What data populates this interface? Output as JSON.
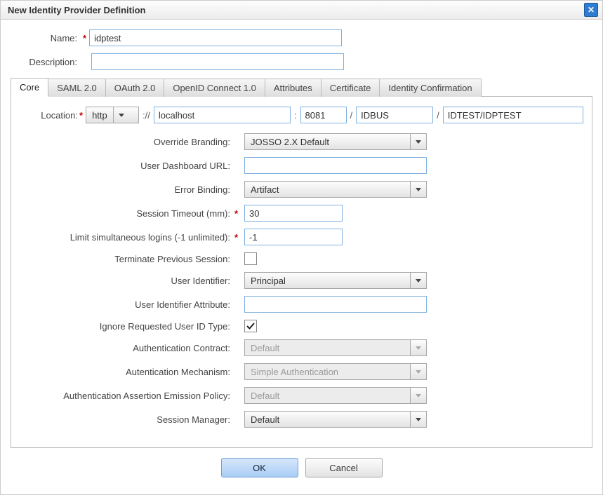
{
  "dialog": {
    "title": "New Identity Provider Definition"
  },
  "header": {
    "name_label": "Name:",
    "name_value": "idptest",
    "description_label": "Description:",
    "description_value": ""
  },
  "tabs": [
    {
      "label": "Core",
      "active": true
    },
    {
      "label": "SAML 2.0",
      "active": false
    },
    {
      "label": "OAuth 2.0",
      "active": false
    },
    {
      "label": "OpenID Connect 1.0",
      "active": false
    },
    {
      "label": "Attributes",
      "active": false
    },
    {
      "label": "Certificate",
      "active": false
    },
    {
      "label": "Identity Confirmation",
      "active": false
    }
  ],
  "core": {
    "location_label": "Location:",
    "protocol": "http",
    "scheme_sep": "://",
    "host": "localhost",
    "colon": ":",
    "port": "8081",
    "slash": "/",
    "context": "IDBUS",
    "path": "IDTEST/IDPTEST",
    "override_branding_label": "Override Branding:",
    "override_branding_value": "JOSSO 2.X Default",
    "user_dashboard_label": "User Dashboard URL:",
    "user_dashboard_value": "",
    "error_binding_label": "Error Binding:",
    "error_binding_value": "Artifact",
    "session_timeout_label": "Session Timeout (mm):",
    "session_timeout_value": "30",
    "limit_logins_label": "Limit simultaneous logins (-1 unlimited):",
    "limit_logins_value": "-1",
    "terminate_prev_label": "Terminate Previous Session:",
    "terminate_prev_checked": false,
    "user_identifier_label": "User Identifier:",
    "user_identifier_value": "Principal",
    "user_identifier_attr_label": "User Identifier Attribute:",
    "user_identifier_attr_value": "",
    "ignore_req_uid_label": "Ignore Requested User ID Type:",
    "ignore_req_uid_checked": true,
    "auth_contract_label": "Authentication Contract:",
    "auth_contract_value": "Default",
    "auth_mechanism_label": "Autentication Mechanism:",
    "auth_mechanism_value": "Simple Authentication",
    "auth_assert_policy_label": "Authentication Assertion Emission Policy:",
    "auth_assert_policy_value": "Default",
    "session_manager_label": "Session Manager:",
    "session_manager_value": "Default"
  },
  "buttons": {
    "ok": "OK",
    "cancel": "Cancel"
  }
}
